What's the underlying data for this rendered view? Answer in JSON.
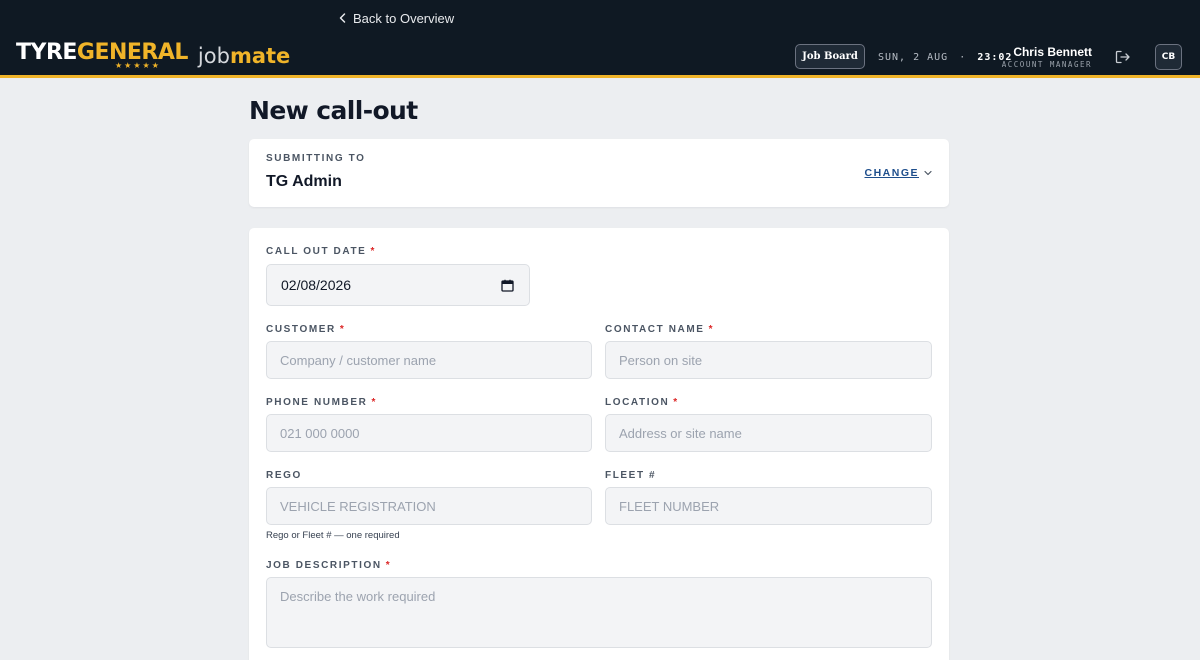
{
  "header": {
    "back_label": "Back to Overview",
    "logo_tyre": "TYRE",
    "logo_general": "GENERAL",
    "logo_stars": "★★★★★",
    "logo_job": "job",
    "logo_mate": "mate",
    "job_board_label": "Job Board",
    "date": "SUN, 2 AUG",
    "separator": "·",
    "time": "23:02",
    "user_name": "Chris Bennett",
    "user_role": "ACCOUNT MANAGER",
    "avatar_initials": "CB"
  },
  "page": {
    "title": "New call-out"
  },
  "submitting": {
    "label": "SUBMITTING TO",
    "value": "TG Admin",
    "change_label": "CHANGE"
  },
  "form": {
    "required_mark": "*",
    "call_out_date": {
      "label": "CALL OUT DATE",
      "value": "02/08/2026"
    },
    "customer": {
      "label": "CUSTOMER",
      "placeholder": "Company / customer name"
    },
    "contact_name": {
      "label": "CONTACT NAME",
      "placeholder": "Person on site"
    },
    "phone_number": {
      "label": "PHONE NUMBER",
      "placeholder": "021 000 0000"
    },
    "location": {
      "label": "LOCATION",
      "placeholder": "Address or site name"
    },
    "rego": {
      "label": "REGO",
      "placeholder": "VEHICLE REGISTRATION"
    },
    "fleet": {
      "label": "FLEET #",
      "placeholder": "FLEET NUMBER"
    },
    "rego_fleet_hint": "Rego or Fleet # — one required",
    "job_description": {
      "label": "JOB DESCRIPTION",
      "placeholder": "Describe the work required"
    }
  },
  "colors": {
    "header_bg": "#0f1923",
    "accent": "#f0b429",
    "page_bg": "#eceef1",
    "link": "#1e4e8c",
    "required": "#dc2626"
  },
  "icons": {
    "back": "chevron-left-icon",
    "logout": "logout-icon",
    "change": "chevron-down-icon",
    "date": "calendar-icon"
  }
}
